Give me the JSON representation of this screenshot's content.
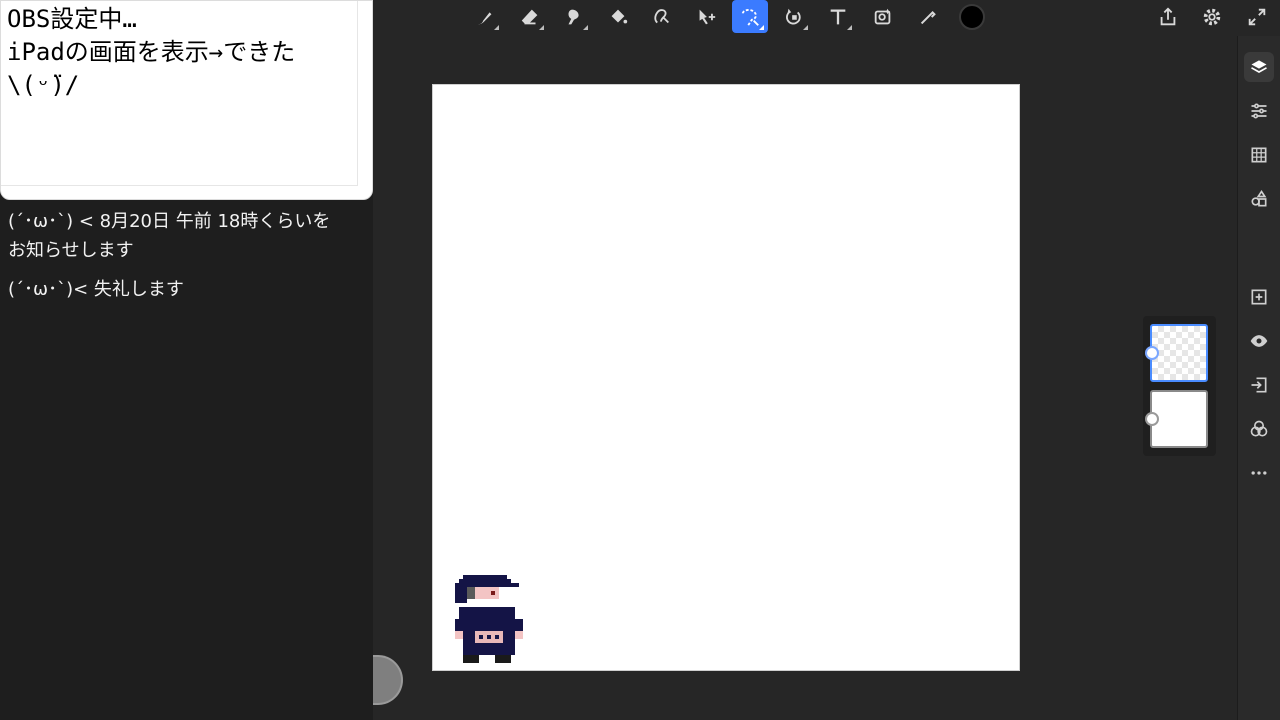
{
  "memo": {
    "line1": "OBS設定中…",
    "line2": "iPadの画面を表示→できた",
    "line3": "\\(ᵕ̈)/"
  },
  "chat": {
    "line1": "(´･ω･`) < 8月20日 午前 18時くらいを",
    "line2": "お知らせします",
    "line3": "(´･ω･`)< 失礼します"
  },
  "toolbar": {
    "tools": [
      "brush-icon",
      "eraser-icon",
      "smudge-icon",
      "fill-icon",
      "lasso-fill-icon",
      "move-icon",
      "magic-selection-icon",
      "transform-icon",
      "text-icon",
      "filter-icon",
      "eyedropper-icon"
    ],
    "active_tool": "magic-selection-icon",
    "color": "#000000",
    "right_actions": [
      "share-icon",
      "settings-icon",
      "fullscreen-icon"
    ]
  },
  "right_rail": {
    "items": [
      "layers-icon",
      "adjustments-icon",
      "grid-icon",
      "shapes-icon",
      "add-layer-icon",
      "visibility-icon",
      "import-icon",
      "blend-icon",
      "more-icon"
    ],
    "active": "layers-icon"
  },
  "colors": {
    "accent": "#3b7bff",
    "background": "#262626",
    "sprite_navy": "#141446",
    "sprite_skin": "#f3c4c4"
  }
}
